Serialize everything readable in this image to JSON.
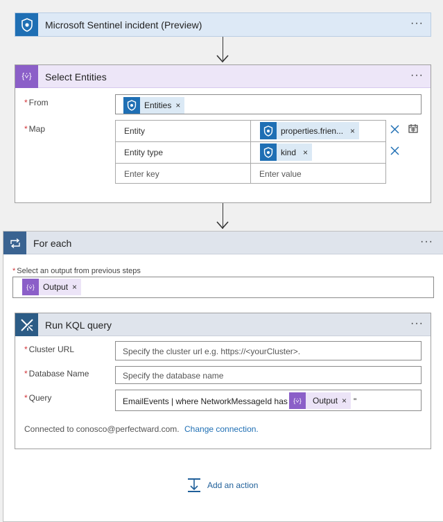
{
  "trigger": {
    "title": "Microsoft Sentinel incident (Preview)",
    "more": "···",
    "icon": "sentinel-shield-icon",
    "color": "#1f6fb4"
  },
  "select_entities": {
    "title": "Select Entities",
    "more": "···",
    "icon_text": "{⩒}",
    "icon_color": "#8b5fc8",
    "from_label": "From",
    "from_token": "Entities",
    "map_label": "Map",
    "rows": [
      {
        "key": "Entity",
        "value_token": "properties.frien..."
      },
      {
        "key": "Entity type",
        "value_token": "kind"
      }
    ],
    "key_placeholder": "Enter key",
    "value_placeholder": "Enter value",
    "token_x": "×"
  },
  "for_each": {
    "title": "For each",
    "more": "···",
    "icon_color": "#3a6391",
    "select_label": "Select an output from previous steps",
    "output_token": "Output"
  },
  "kql": {
    "title": "Run KQL query",
    "more": "···",
    "icon_color": "#2c5c86",
    "cluster_label": "Cluster URL",
    "cluster_placeholder": "Specify the cluster url e.g. https://<yourCluster>.",
    "db_label": "Database Name",
    "db_placeholder": "Specify the database name",
    "query_label": "Query",
    "query_prefix": "EmailEvents | where NetworkMessageId has \"",
    "query_token": "Output",
    "query_suffix": "\"",
    "connected_text": "Connected to conosco@perfectward.com.",
    "change_connection": "Change connection."
  },
  "add_action": {
    "label": "Add an action"
  }
}
